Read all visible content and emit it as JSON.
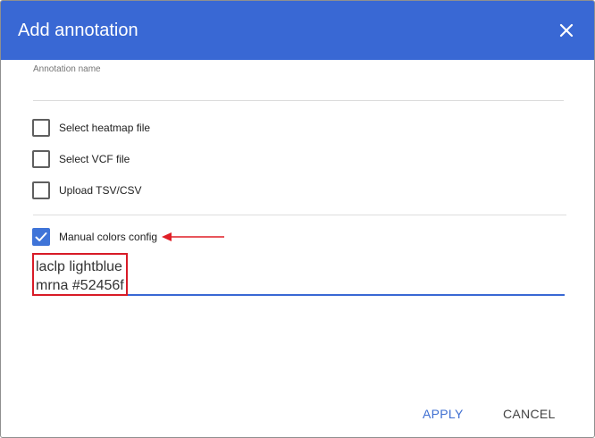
{
  "dialog": {
    "title": "Add annotation",
    "close_icon": "close-icon"
  },
  "form": {
    "annotation_name_label": "Annotation name",
    "annotation_name_value": "",
    "options": [
      {
        "label": "Select heatmap file",
        "checked": false
      },
      {
        "label": "Select VCF file",
        "checked": false
      },
      {
        "label": "Upload TSV/CSV",
        "checked": false
      },
      {
        "label": "Manual colors config",
        "checked": true
      }
    ],
    "manual_colors": {
      "lines": [
        "laclp lightblue",
        "mrna #52456f"
      ]
    }
  },
  "actions": {
    "apply_label": "APPLY",
    "cancel_label": "CANCEL"
  },
  "colors": {
    "header": "#3968d4",
    "accent": "#3f74d8",
    "highlight": "#d81b27"
  }
}
